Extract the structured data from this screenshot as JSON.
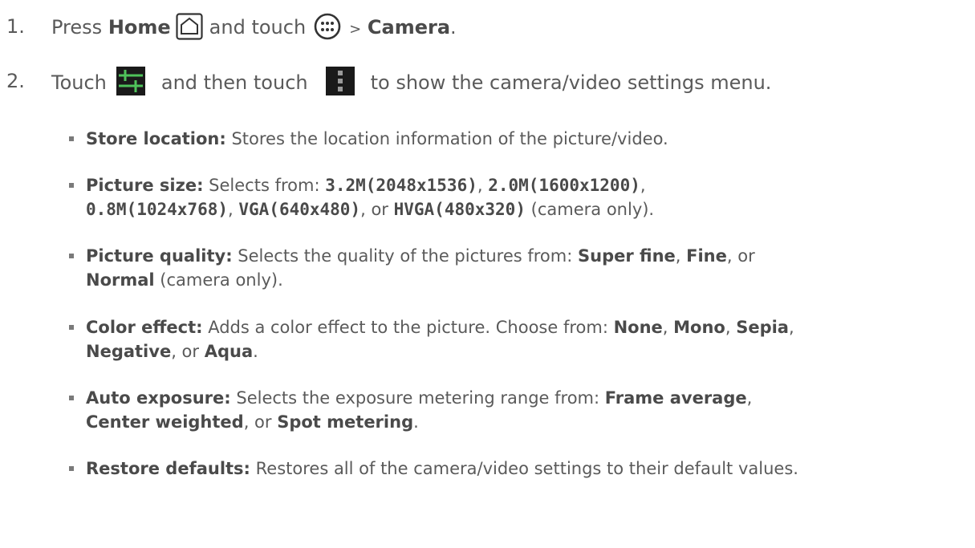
{
  "step1": {
    "number": "1.",
    "press": "Press",
    "home": "Home",
    "and_touch": "and touch",
    "gt": ">",
    "camera": "Camera",
    "period": "."
  },
  "step2": {
    "number": "2.",
    "touch": "Touch",
    "and_then_touch": "and then touch",
    "rest": "to show the camera/video settings menu."
  },
  "bullets": {
    "store_location": {
      "label": "Store location:",
      "text": " Stores the location information of the picture/video."
    },
    "picture_size": {
      "label": "Picture size:",
      "intro": " Selects from: ",
      "opt1": "3.2M(2048x1536)",
      "sep1": ", ",
      "opt2": "2.0M(1600x1200)",
      "sep2": ",",
      "opt3": "0.8M(1024x768)",
      "sep3": ", ",
      "opt4": "VGA(640x480)",
      "sep4": ", or ",
      "opt5": "HVGA(480x320)",
      "tail": " (camera only)."
    },
    "picture_quality": {
      "label": "Picture quality:",
      "intro": " Selects the quality of the pictures from: ",
      "opt1": "Super fine",
      "sep1": ", ",
      "opt2": "Fine",
      "sep2": ", or",
      "opt3": "Normal",
      "tail": " (camera only)."
    },
    "color_effect": {
      "label": "Color effect:",
      "intro": " Adds a color effect to the picture. Choose from: ",
      "opt1": "None",
      "sep1": ", ",
      "opt2": "Mono",
      "sep2": ", ",
      "opt3": "Sepia",
      "sep3": ",",
      "opt4": "Negative",
      "sep4": ", or ",
      "opt5": "Aqua",
      "tail": "."
    },
    "auto_exposure": {
      "label": "Auto exposure:",
      "intro": " Selects the exposure metering range from: ",
      "opt1": "Frame average",
      "sep1": ",",
      "opt2": "Center weighted",
      "sep2": ", or ",
      "opt3": "Spot metering",
      "tail": "."
    },
    "restore_defaults": {
      "label": "Restore defaults:",
      "text": " Restores all of the camera/video settings to their default values."
    }
  },
  "icons": {
    "home": "home-icon",
    "apps": "apps-icon",
    "sliders": "sliders-icon",
    "menu": "menu-icon"
  }
}
